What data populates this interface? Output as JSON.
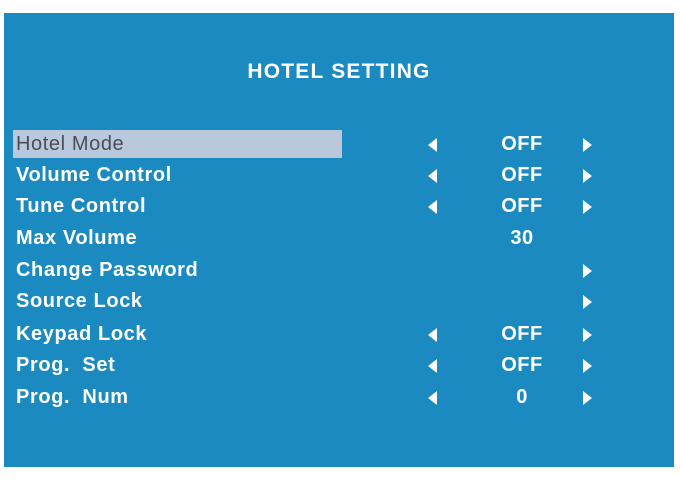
{
  "menu": {
    "title": "HOTEL SETTING",
    "items": [
      {
        "label": "Hotel Mode",
        "value": "OFF",
        "left_arrow": true,
        "right_arrow": true,
        "selected": true
      },
      {
        "label": "Volume Control",
        "value": "OFF",
        "left_arrow": true,
        "right_arrow": true,
        "selected": false
      },
      {
        "label": "Tune Control",
        "value": "OFF",
        "left_arrow": true,
        "right_arrow": true,
        "selected": false
      },
      {
        "label": "Max Volume",
        "value": "30",
        "left_arrow": false,
        "right_arrow": false,
        "selected": false
      },
      {
        "label": "Change Password",
        "value": "",
        "left_arrow": false,
        "right_arrow": true,
        "selected": false
      },
      {
        "label": "Source Lock",
        "value": "",
        "left_arrow": false,
        "right_arrow": true,
        "selected": false
      },
      {
        "label": "Keypad Lock",
        "value": "OFF",
        "left_arrow": true,
        "right_arrow": true,
        "selected": false
      },
      {
        "label": "Prog.  Set",
        "value": "OFF",
        "left_arrow": true,
        "right_arrow": true,
        "selected": false
      },
      {
        "label": "Prog.  Num",
        "value": "0",
        "left_arrow": true,
        "right_arrow": true,
        "selected": false
      }
    ]
  },
  "icons": {
    "left": "arrow-left-icon",
    "right": "arrow-right-icon"
  },
  "colors": {
    "background": "#1a8ac1",
    "highlight": "#b9c8dc",
    "highlight_text": "#4a4f57",
    "text": "#ffffff"
  }
}
